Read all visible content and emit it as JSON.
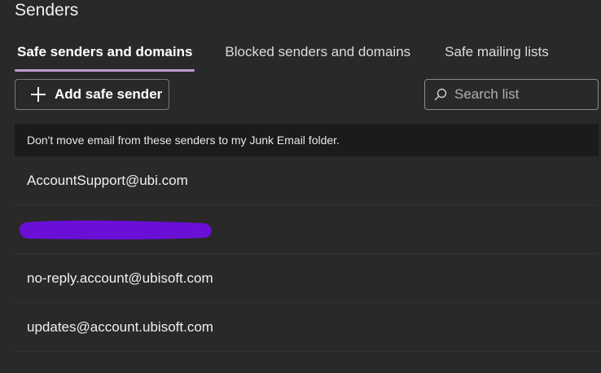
{
  "header": {
    "title": "Senders"
  },
  "tabs": [
    {
      "label": "Safe senders and domains",
      "active": true
    },
    {
      "label": "Blocked senders and domains",
      "active": false
    },
    {
      "label": "Safe mailing lists",
      "active": false
    }
  ],
  "toolbar": {
    "add_label": "Add safe sender",
    "add_icon": "plus-icon"
  },
  "search": {
    "placeholder": "Search list",
    "value": "",
    "icon": "search-icon"
  },
  "info": {
    "text": "Don't move email from these senders to my Junk Email folder."
  },
  "senders": [
    {
      "address": "AccountSupport@ubi.com",
      "redacted": false
    },
    {
      "address": "",
      "redacted": true
    },
    {
      "address": "no-reply.account@ubisoft.com",
      "redacted": false
    },
    {
      "address": "updates@account.ubisoft.com",
      "redacted": false
    }
  ],
  "colors": {
    "background": "#292929",
    "banner": "#1b1b1b",
    "tab_underline": "#c39bd3",
    "redaction": "#6a0fd6"
  }
}
